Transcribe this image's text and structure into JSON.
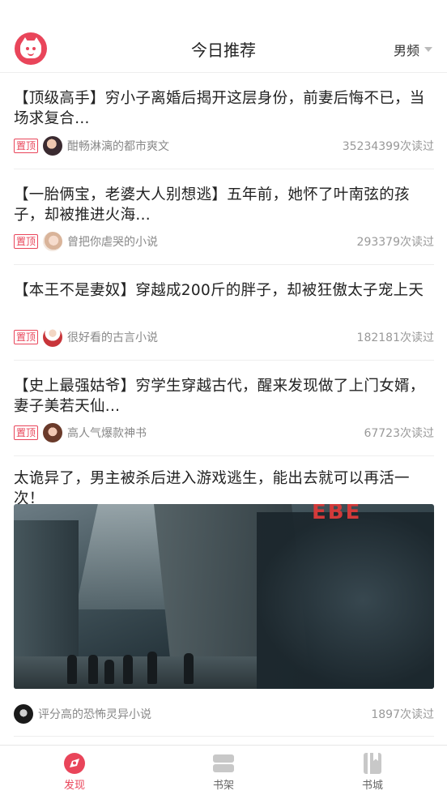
{
  "header": {
    "title": "今日推荐",
    "gender_filter": "男频"
  },
  "articles": [
    {
      "headline": "【顶级高手】穷小子离婚后揭开这层身份，前妻后悔不已，当场求复合...",
      "badge": "置顶",
      "author": "酣畅淋漓的都市爽文",
      "reads": "35234399次读过"
    },
    {
      "headline": "【一胎俩宝，老婆大人别想逃】五年前，她怀了叶南弦的孩子，却被推进火海...",
      "badge": "置顶",
      "author": "曾把你虐哭的小说",
      "reads": "293379次读过"
    },
    {
      "headline": "【本王不是妻奴】穿越成200斤的胖子，却被狂傲太子宠上天",
      "badge": "置顶",
      "author": "很好看的古言小说",
      "reads": "182181次读过"
    },
    {
      "headline": "【史上最强姑爷】穷学生穿越古代，醒来发现做了上门女婿，妻子美若天仙...",
      "badge": "置顶",
      "author": "高人气爆款神书",
      "reads": "67723次读过"
    },
    {
      "headline": "太诡异了，男主被杀后进入游戏逃生，能出去就可以再活一次！",
      "cover_text": "EBE",
      "author": "评分高的恐怖灵异小说",
      "reads": "1897次读过"
    }
  ],
  "tabs": [
    {
      "label": "发现",
      "icon": "discover-icon",
      "active": true
    },
    {
      "label": "书架",
      "icon": "bookshelf-icon",
      "active": false
    },
    {
      "label": "书城",
      "icon": "bookstore-icon",
      "active": false
    }
  ],
  "colors": {
    "accent": "#e9455a",
    "text": "#222222",
    "muted": "#999999"
  }
}
